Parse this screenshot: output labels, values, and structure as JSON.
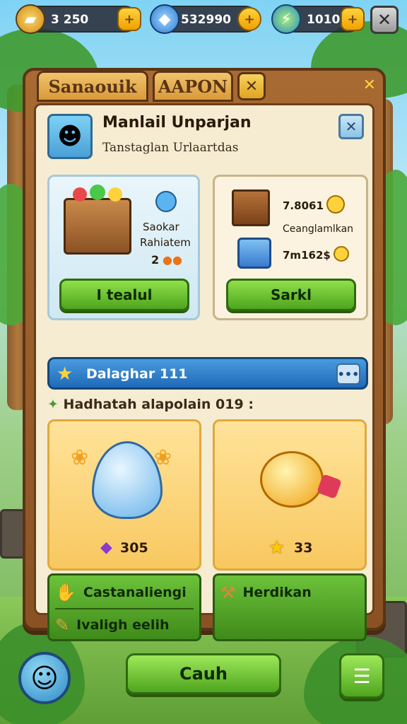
{
  "resources": {
    "gold": {
      "value": "3   250",
      "icon": "gold-bar-icon"
    },
    "gems": {
      "value": "532990",
      "icon": "blue-gem-icon"
    },
    "energy": {
      "value": "1010",
      "icon": "lightning-icon"
    }
  },
  "tabs": {
    "tab1": "Sanaouik",
    "tab2": "AAPON"
  },
  "profile": {
    "name": "Manlail Unparjan",
    "subtitle": "Tanstaglan Urlaartdas"
  },
  "card_left": {
    "item_name": "Saokar",
    "item_sub": "Rahiatem",
    "item_count": "2",
    "button": "I tealul"
  },
  "card_right": {
    "line1": "7.8061",
    "line2": "Ceanglamlkan",
    "line3": "7m162$",
    "button": "Sarkl"
  },
  "banner": {
    "label": "Dalaghar 111",
    "button": "•••"
  },
  "section": {
    "title": "Hadhatah alapolain 019 :"
  },
  "reward_left": {
    "value": "305"
  },
  "reward_right": {
    "value": "33"
  },
  "actions": {
    "left_row1": "Castanaliengi",
    "left_row2": "Ivaligh eelih",
    "right_row1": "Herdikan"
  },
  "bottom": {
    "main_button": "Cauh"
  }
}
